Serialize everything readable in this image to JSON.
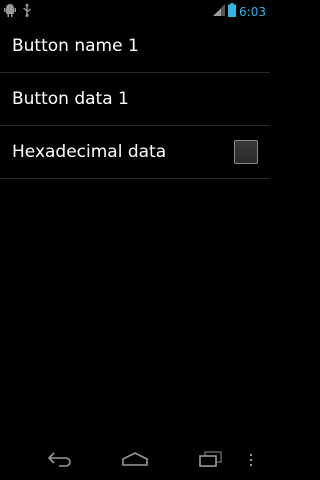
{
  "status_bar": {
    "time": "6:03",
    "icons": [
      "android-debug-icon",
      "usb-icon",
      "signal-icon",
      "battery-icon"
    ]
  },
  "list": {
    "items": [
      {
        "label": "Button name 1"
      },
      {
        "label": "Button data 1"
      },
      {
        "label": "Hexadecimal data",
        "checked": false
      }
    ]
  },
  "nav_bar": {
    "buttons": [
      "back-icon",
      "home-icon",
      "recent-apps-icon",
      "menu-icon"
    ]
  },
  "colors": {
    "background": "#000000",
    "clock": "#33b5e5",
    "text": "#ffffff",
    "divider": "#2a2a2a"
  }
}
